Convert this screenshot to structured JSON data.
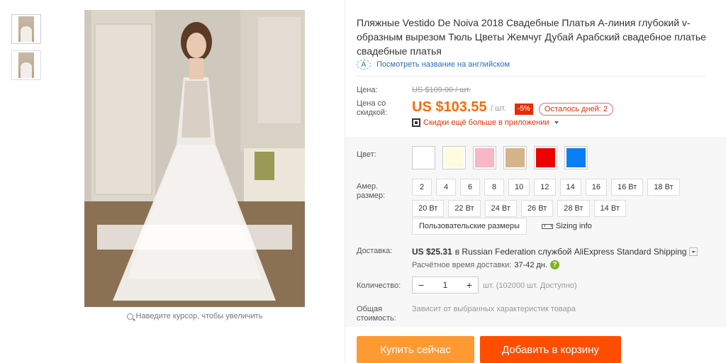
{
  "gallery": {
    "thumbnails": [
      "thumbnail-1",
      "thumbnail-2"
    ],
    "zoom_hint": "Наведите курсор, чтобы увеличить"
  },
  "product": {
    "title": "Пляжные Vestido De Noiva 2018 Свадебные Платья А-линия глубокий v-образным вырезом Тюль Цветы Жемчуг Дубай Арабский свадебное платье свадебные платья",
    "translate_link": "Посмотреть название на английском",
    "translate_icon": "translate-icon"
  },
  "pricing": {
    "price_label": "Цена:",
    "old_price": "US $109.00 / шт.",
    "sale_label": "Цена со скидкой:",
    "sale_price": "US $103.55",
    "unit": "/ шт.",
    "discount": "-5%",
    "days_left": "Осталось дней: 2",
    "app_deal": "Скидки ещё больше в приложении"
  },
  "color": {
    "label": "Цвет:",
    "swatches": [
      "#ffffff",
      "#fffbe0",
      "#f8b6c6",
      "#d4b48a",
      "#ee0000",
      "#0a7ef5"
    ]
  },
  "size": {
    "label": "Амер. размер:",
    "options_row1": [
      "2",
      "4",
      "6",
      "8",
      "10",
      "12",
      "14",
      "16",
      "16 Вт",
      "18 Вт"
    ],
    "options_row2": [
      "20 Вт",
      "22 Вт",
      "24 Вт",
      "26 Вт",
      "28 Вт",
      "14 Вт"
    ],
    "custom": "Пользовательские размеры",
    "sizing_info": "Sizing info"
  },
  "shipping": {
    "label": "Доставка:",
    "price": "US $25.31",
    "text": "в Russian Federation службой AliExpress Standard Shipping",
    "time_label": "Расчётное время доставки:",
    "time_value": "37-42 дн."
  },
  "quantity": {
    "label": "Количество:",
    "minus": "−",
    "value": "1",
    "plus": "+",
    "available": "шт. (102000 шт. Доступно)"
  },
  "total": {
    "label": "Общая стоимость:",
    "note": "Зависит от выбранных характеристик товара"
  },
  "actions": {
    "buy_now": "Купить сейчас",
    "add_to_cart": "Добавить в корзину"
  }
}
